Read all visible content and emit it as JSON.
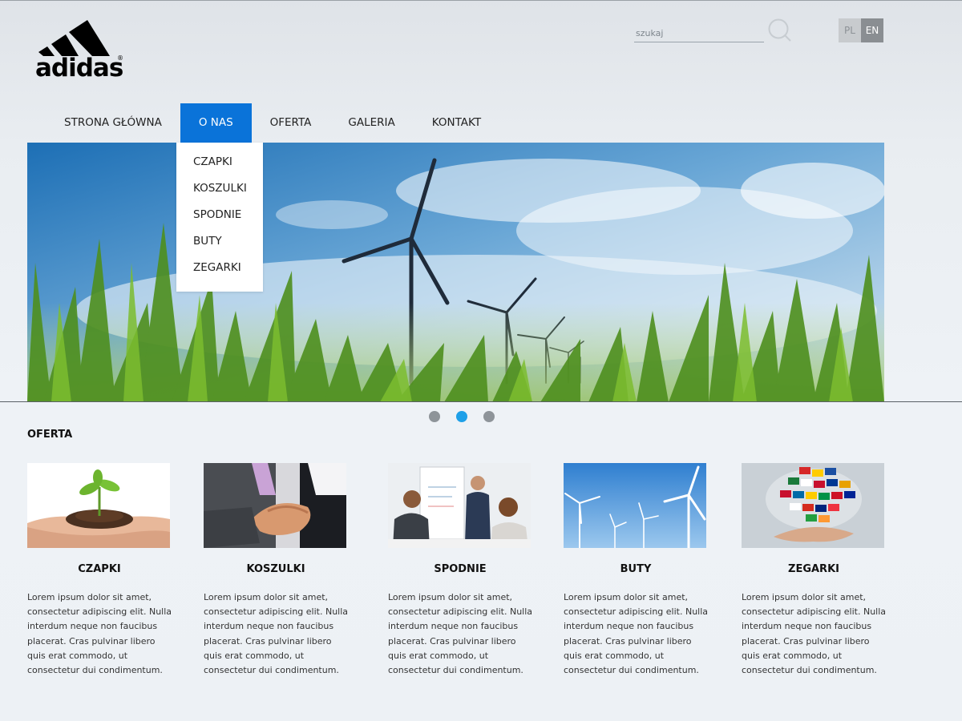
{
  "brand": {
    "name": "adidas",
    "registered": "®"
  },
  "search": {
    "placeholder": "szukaj"
  },
  "languages": [
    "PL",
    "EN"
  ],
  "active_language": "EN",
  "nav": {
    "items": [
      "STRONA GŁÓWNA",
      "O NAS",
      "OFERTA",
      "GALERIA",
      "KONTAKT"
    ],
    "active_index": 1,
    "dropdown": [
      "CZAPKI",
      "KOSZULKI",
      "SPODNIE",
      "BUTY",
      "ZEGARKI"
    ]
  },
  "slider": {
    "slide_count": 3,
    "active_slide": 1
  },
  "offer": {
    "title": "OFERTA",
    "cards": [
      {
        "title": "CZAPKI",
        "text": "Lorem ipsum dolor sit amet, consectetur adipiscing elit. Nulla interdum neque non faucibus placerat. Cras pulvinar libero quis erat commodo, ut consectetur dui condimentum."
      },
      {
        "title": "KOSZULKI",
        "text": "Lorem ipsum dolor sit amet, consectetur adipiscing elit. Nulla interdum neque non faucibus placerat. Cras pulvinar libero quis erat commodo, ut consectetur dui condimentum."
      },
      {
        "title": "SPODNIE",
        "text": "Lorem ipsum dolor sit amet, consectetur adipiscing elit. Nulla interdum neque non faucibus placerat. Cras pulvinar libero quis erat commodo, ut consectetur dui condimentum."
      },
      {
        "title": "BUTY",
        "text": "Lorem ipsum dolor sit amet, consectetur adipiscing elit. Nulla interdum neque non faucibus placerat. Cras pulvinar libero quis erat commodo, ut consectetur dui condimentum."
      },
      {
        "title": "ZEGARKI",
        "text": "Lorem ipsum dolor sit amet, consectetur adipiscing elit. Nulla interdum neque non faucibus placerat. Cras pulvinar libero quis erat commodo, ut consectetur dui condimentum."
      }
    ]
  },
  "colors": {
    "accent": "#0a73d9",
    "dot_active": "#1ea0e8",
    "dot": "#8e9499"
  }
}
